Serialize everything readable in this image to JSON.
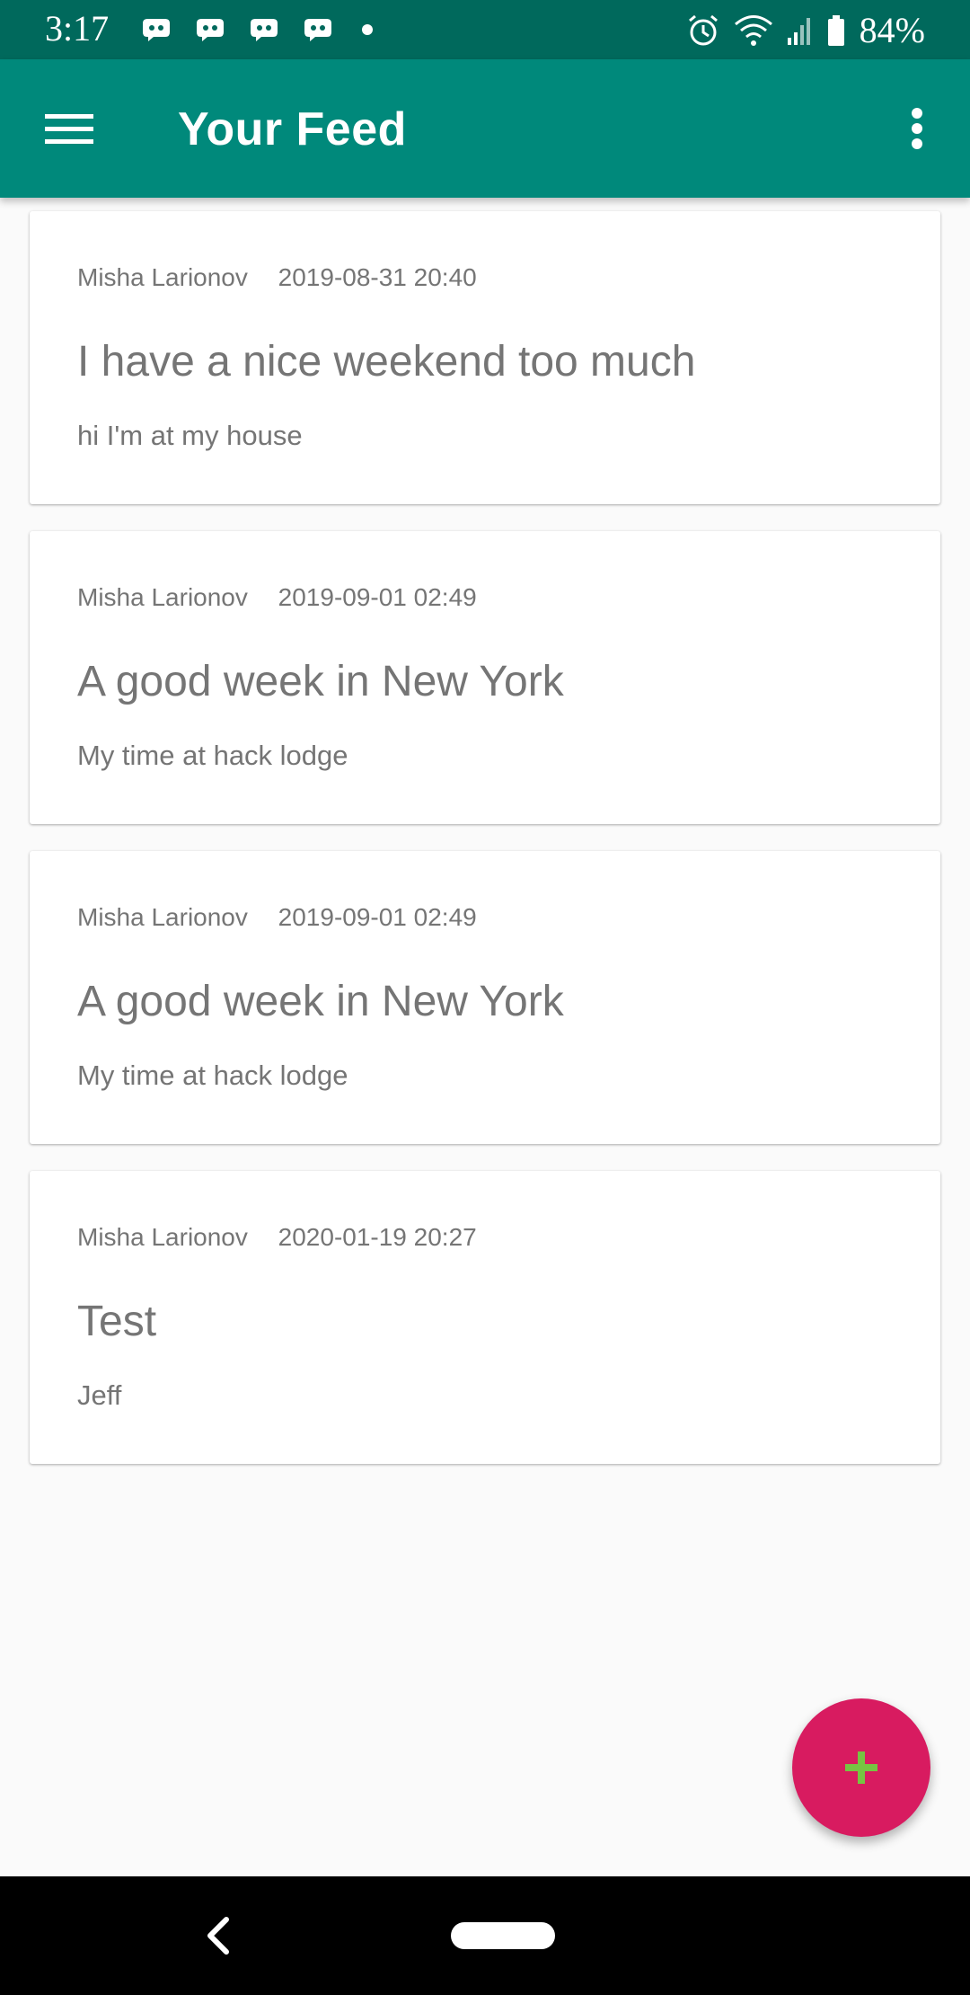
{
  "status_bar": {
    "time": "3:17",
    "battery": "84%",
    "notification_icons": [
      "discord-icon",
      "discord-icon",
      "discord-icon",
      "discord-icon",
      "dot-icon"
    ],
    "right_icons": [
      "alarm-icon",
      "wifi-icon",
      "signal-icon",
      "battery-icon"
    ]
  },
  "app_bar": {
    "title": "Your Feed",
    "menu_icon": "hamburger-menu-icon",
    "overflow_icon": "more-vert-icon"
  },
  "posts": [
    {
      "author": "Misha Larionov",
      "date": "2019-08-31 20:40",
      "title": "I have a nice weekend too much",
      "body": "hi I'm at my house"
    },
    {
      "author": "Misha Larionov",
      "date": "2019-09-01 02:49",
      "title": "A good week in New York",
      "body": "My time at hack lodge"
    },
    {
      "author": "Misha Larionov",
      "date": "2019-09-01 02:49",
      "title": "A good week in New York",
      "body": "My time at hack lodge"
    },
    {
      "author": "Misha Larionov",
      "date": "2020-01-19 20:27",
      "title": "Test",
      "body": "Jeff"
    }
  ],
  "fab": {
    "icon": "plus-icon"
  },
  "nav_bar": {
    "back_icon": "back-chevron-icon",
    "home_icon": "home-pill-icon"
  },
  "colors": {
    "status_bar": "#00695c",
    "app_bar": "#00897b",
    "fab": "#d81b60",
    "fab_icon": "#76c442",
    "text_secondary": "#757575"
  }
}
